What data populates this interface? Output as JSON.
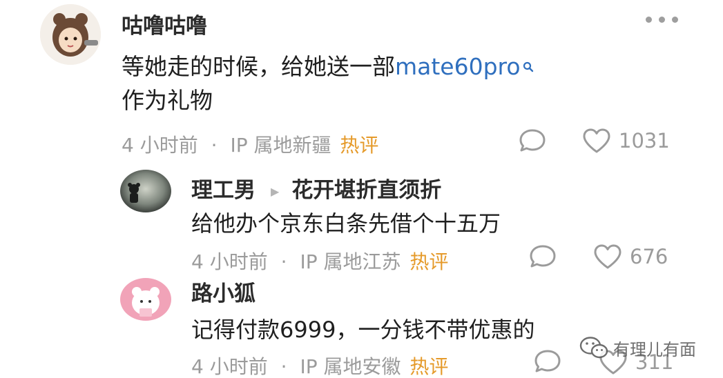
{
  "more_menu": {
    "icon": "more-horizontal-icon"
  },
  "main_comment": {
    "username": "咕噜咕噜",
    "text_prefix": "等她走的时候，给她送一部",
    "link_text": "mate60pro",
    "text_line2": "作为礼物",
    "meta": {
      "time": "4 小时前",
      "sep": "·",
      "ip": "IP 属地新疆",
      "badge": "热评"
    },
    "like_count": "1031"
  },
  "replies": [
    {
      "username": "理工男",
      "reply_to": "花开堪折直须折",
      "text": "给他办个京东白条先借个十五万",
      "meta": {
        "time": "4 小时前",
        "sep": "·",
        "ip": "IP 属地江苏",
        "badge": "热评"
      },
      "like_count": "676"
    },
    {
      "username": "路小狐",
      "text": "记得付款6999，一分钱不带优惠的",
      "meta": {
        "time": "4 小时前",
        "sep": "·",
        "ip": "IP 属地安徽",
        "badge": "热评"
      },
      "like_count": "311"
    }
  ],
  "watermark": {
    "text": "有理儿有面",
    "icon": "wechat-icon"
  },
  "colors": {
    "link": "#2f6fbe",
    "hot_badge": "#e59a2a",
    "meta": "#9b9b9b"
  }
}
